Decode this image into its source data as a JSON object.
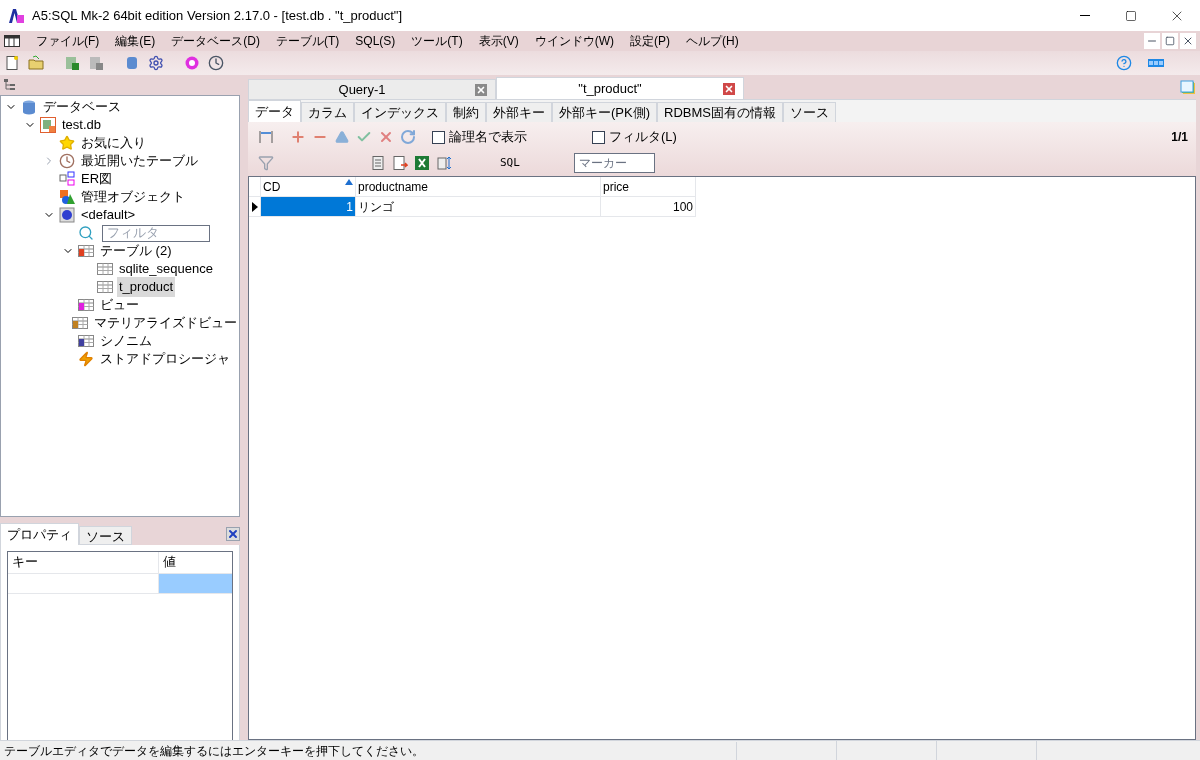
{
  "window": {
    "title": "A5:SQL Mk-2 64bit edition Version 2.17.0 - [test.db . \"t_product\"]"
  },
  "menu": [
    "ファイル(F)",
    "編集(E)",
    "データベース(D)",
    "テーブル(T)",
    "SQL(S)",
    "ツール(T)",
    "表示(V)",
    "ウインドウ(W)",
    "設定(P)",
    "ヘルプ(H)"
  ],
  "tree": [
    {
      "label": "データベース",
      "kind": "database",
      "expanded": true,
      "selected": false,
      "children": [
        {
          "label": "test.db",
          "kind": "dbfile",
          "expanded": true,
          "selected": false,
          "children": [
            {
              "label": "お気に入り",
              "kind": "star",
              "selected": false
            },
            {
              "label": "最近開いたテーブル",
              "kind": "clock",
              "expanded": false,
              "selected": false
            },
            {
              "label": "ER図",
              "kind": "er",
              "selected": false
            },
            {
              "label": "管理オブジェクト",
              "kind": "admin",
              "selected": false
            },
            {
              "label": "<default>",
              "kind": "schema",
              "expanded": true,
              "selected": false,
              "children": [
                {
                  "kind": "filter",
                  "placeholder": "フィルタ"
                },
                {
                  "label": "テーブル (2)",
                  "kind": "tables",
                  "expanded": true,
                  "selected": false,
                  "children": [
                    {
                      "label": "sqlite_sequence",
                      "kind": "table",
                      "selected": false
                    },
                    {
                      "label": "t_product",
                      "kind": "table",
                      "selected": true
                    }
                  ]
                },
                {
                  "label": "ビュー",
                  "kind": "view",
                  "selected": false
                },
                {
                  "label": "マテリアライズドビュー",
                  "kind": "mview",
                  "selected": false
                },
                {
                  "label": "シノニム",
                  "kind": "synonym",
                  "selected": false
                },
                {
                  "label": "ストアドプロシージャ",
                  "kind": "proc",
                  "selected": false
                }
              ]
            }
          ]
        }
      ]
    }
  ],
  "properties": {
    "tabs": [
      {
        "label": "プロパティ",
        "selected": true
      },
      {
        "label": "ソース",
        "selected": false
      }
    ],
    "columns": [
      "キー",
      "値"
    ]
  },
  "doc_tabs": [
    {
      "label": "Query-1",
      "selected": false
    },
    {
      "label": "\"t_product\"",
      "selected": true
    }
  ],
  "sub_tabs": [
    {
      "label": "データ",
      "selected": true
    },
    {
      "label": "カラム",
      "selected": false
    },
    {
      "label": "インデックス",
      "selected": false
    },
    {
      "label": "制約",
      "selected": false
    },
    {
      "label": "外部キー",
      "selected": false
    },
    {
      "label": "外部キー(PK側)",
      "selected": false
    },
    {
      "label": "RDBMS固有の情報",
      "selected": false
    },
    {
      "label": "ソース",
      "selected": false
    }
  ],
  "options": [
    {
      "label": "論理名で表示",
      "checked": false
    },
    {
      "label": "フィルタ(L)",
      "checked": false
    }
  ],
  "page": "1/1",
  "sql_button": "SQL",
  "marker": {
    "placeholder": "マーカー"
  },
  "grid": {
    "columns": [
      {
        "label": "CD",
        "sorted": true,
        "kind": "number"
      },
      {
        "label": "productname",
        "sorted": false,
        "kind": "text"
      },
      {
        "label": "price",
        "sorted": false,
        "kind": "number"
      }
    ],
    "rows": [
      {
        "cells": [
          "1",
          "リンゴ",
          "100"
        ],
        "current": true
      }
    ]
  },
  "status_bar": "テーブルエディタでデータを編集するにはエンターキーを押下してください。"
}
